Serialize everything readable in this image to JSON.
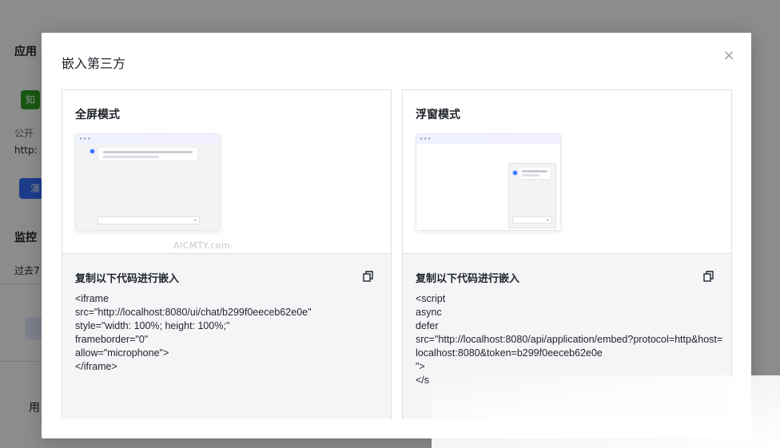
{
  "background": {
    "app_title_fragment": "应用",
    "tag_text": "知",
    "public_label": "公开",
    "url_fragment": "http:",
    "demo_button_fragment": "演",
    "monitor_fragment": "监控",
    "period_fragment": "过去7",
    "user_fragment": "用"
  },
  "modal": {
    "title": "嵌入第三方",
    "close_glyph": "×",
    "cards": [
      {
        "title": "全屏模式",
        "copy_label": "复制以下代码进行嵌入",
        "code": "<iframe\nsrc=\"http://localhost:8080/ui/chat/b299f0eeceb62e0e\"\nstyle=\"width: 100%; height: 100%;\"\nframeborder=\"0\"\nallow=\"microphone\">\n</iframe>"
      },
      {
        "title": "浮窗模式",
        "copy_label": "复制以下代码进行嵌入",
        "code": "<script\nasync\ndefer\nsrc=\"http://localhost:8080/api/application/embed?protocol=http&host=localhost:8080&token=b299f0eeceb62e0e\n\">\n</s"
      }
    ],
    "watermark": "AICMTY.com",
    "preview_dots": "•••",
    "preview_send": "▸"
  },
  "colors": {
    "accent": "#3370ff",
    "tag_green": "#2ea121"
  },
  "icons": {
    "close": "close-icon",
    "copy": "copy-icon"
  }
}
